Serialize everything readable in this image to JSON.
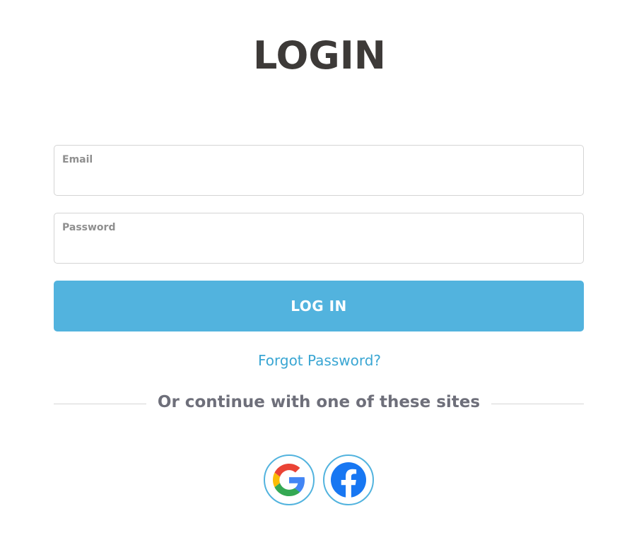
{
  "page": {
    "title": "LOGIN"
  },
  "form": {
    "email": {
      "label": "Email",
      "value": ""
    },
    "password": {
      "label": "Password",
      "value": ""
    },
    "submit_label": "LOG IN",
    "forgot_password_label": "Forgot Password?"
  },
  "social": {
    "divider_text": "Or continue with one of these sites",
    "providers": [
      {
        "icon": "google-icon"
      },
      {
        "icon": "facebook-icon"
      }
    ]
  },
  "colors": {
    "accent": "#52b3de",
    "link": "#3aa6d3",
    "title": "#3d3a38",
    "facebook": "#1877f2"
  }
}
